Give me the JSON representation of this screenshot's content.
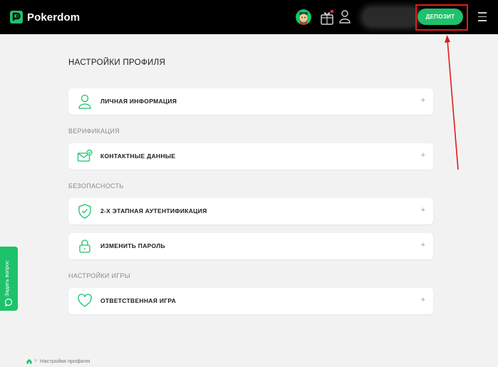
{
  "header": {
    "logo_text": "Pokerdom",
    "deposit_label": "ДЕПОЗИТ"
  },
  "page": {
    "title": "НАСТРОЙКИ ПРОФИЛЯ"
  },
  "sections": {
    "verification": "ВЕРИФИКАЦИЯ",
    "security": "БЕЗОПАСНОСТЬ",
    "game": "НАСТРОЙКИ ИГРЫ"
  },
  "cards": {
    "personal": {
      "label": "ЛИЧНАЯ ИНФОРМАЦИЯ",
      "icon": "user-icon"
    },
    "contacts": {
      "label": "КОНТАКТНЫЕ ДАННЫЕ",
      "icon": "mail-check-icon"
    },
    "twofa": {
      "label": "2-Х ЭТАПНАЯ АУТЕНТИФИКАЦИЯ",
      "icon": "shield-check-icon"
    },
    "password": {
      "label": "ИЗМЕНИТЬ ПАРОЛЬ",
      "icon": "lock-icon"
    },
    "responsible": {
      "label": "ОТВЕТСТВЕННАЯ ИГРА",
      "icon": "heart-icon"
    },
    "expand_symbol": "+"
  },
  "side_tab": {
    "label": "Задать вопрос"
  },
  "breadcrumb": {
    "separator": ">",
    "current": "Настройки профиля"
  },
  "colors": {
    "accent": "#1ec26b",
    "header_bg": "#000000",
    "page_bg": "#f2f2f2",
    "annotation": "#e01b1b"
  }
}
